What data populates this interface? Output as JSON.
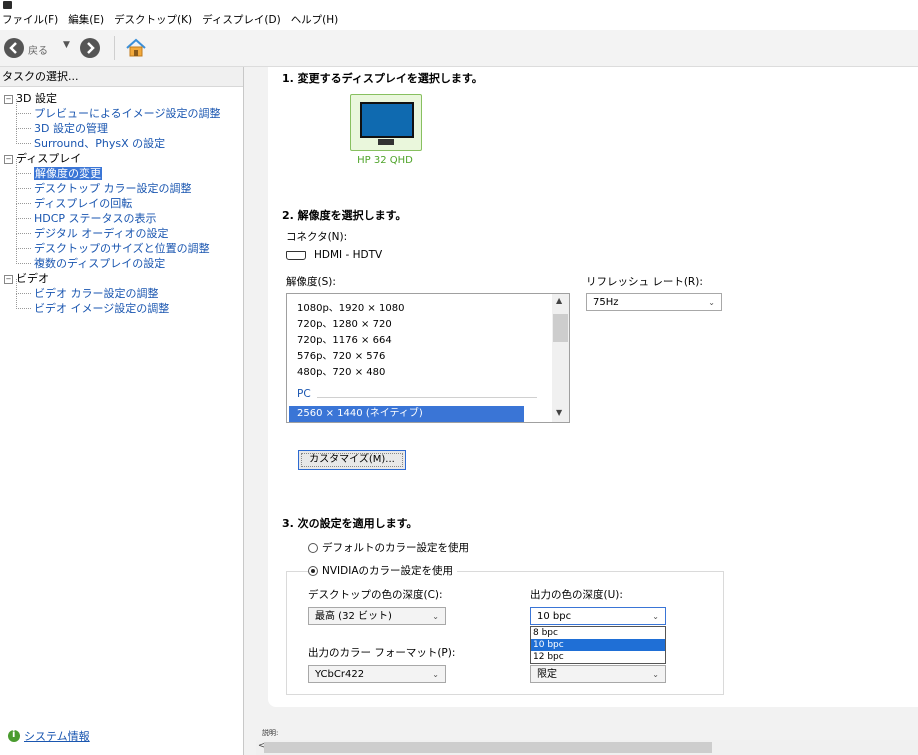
{
  "menubar": {
    "items": [
      "ファイル(F)",
      "編集(E)",
      "デスクトップ(K)",
      "ディスプレイ(D)",
      "ヘルプ(H)"
    ]
  },
  "toolbar": {
    "back_label": "戻る",
    "back_icon": "back-arrow-icon",
    "forward_icon": "forward-arrow-icon",
    "home_icon": "home-icon"
  },
  "sidebar": {
    "header": "タスクの選択...",
    "tree": [
      {
        "label": "3D 設定",
        "level": 0,
        "expander": "−"
      },
      {
        "label": "プレビューによるイメージ設定の調整",
        "level": 1
      },
      {
        "label": "3D 設定の管理",
        "level": 1
      },
      {
        "label": "Surround、PhysX の設定",
        "level": 1
      },
      {
        "label": "ディスプレイ",
        "level": 0,
        "expander": "−"
      },
      {
        "label": "解像度の変更",
        "level": 1,
        "selected": true
      },
      {
        "label": "デスクトップ カラー設定の調整",
        "level": 1
      },
      {
        "label": "ディスプレイの回転",
        "level": 1
      },
      {
        "label": "HDCP ステータスの表示",
        "level": 1
      },
      {
        "label": "デジタル オーディオの設定",
        "level": 1
      },
      {
        "label": "デスクトップのサイズと位置の調整",
        "level": 1
      },
      {
        "label": "複数のディスプレイの設定",
        "level": 1
      },
      {
        "label": "ビデオ",
        "level": 0,
        "expander": "−"
      },
      {
        "label": "ビデオ カラー設定の調整",
        "level": 1
      },
      {
        "label": "ビデオ イメージ設定の調整",
        "level": 1
      }
    ],
    "system_info_link": "システム情報"
  },
  "section1": {
    "title": "1. 変更するディスプレイを選択します。",
    "monitor_label": "HP 32 QHD"
  },
  "section2": {
    "title": "2. 解像度を選択します。",
    "connector_label": "コネクタ(N):",
    "connector_value": "HDMI - HDTV",
    "resolution_label": "解像度(S):",
    "refresh_label": "リフレッシュ レート(R):",
    "refresh_value": "75Hz",
    "resolutions": [
      "1080p、1920 × 1080",
      "720p、1280 × 720",
      "720p、1176 × 664",
      "576p、720 × 576",
      "480p、720 × 480"
    ],
    "pc_group_label": "PC",
    "selected_resolution": "2560 × 1440 (ネイティブ)",
    "customize_button": "カスタマイズ(M)..."
  },
  "section3": {
    "title": "3. 次の設定を適用します。",
    "radio_default": "デフォルトのカラー設定を使用",
    "radio_nvidia": "NVIDIAのカラー設定を使用",
    "desktop_depth_label": "デスクトップの色の深度(C):",
    "desktop_depth_value": "最高 (32 ビット)",
    "output_depth_label": "出力の色の深度(U):",
    "output_depth_value": "10 bpc",
    "output_depth_options": [
      "8 bpc",
      "10 bpc",
      "12 bpc"
    ],
    "output_depth_highlighted": "10 bpc",
    "output_format_label": "出力のカラー フォーマット(P):",
    "output_format_value": "YCbCr422",
    "output_range_value": "限定"
  },
  "status": {
    "text": "説明:"
  }
}
